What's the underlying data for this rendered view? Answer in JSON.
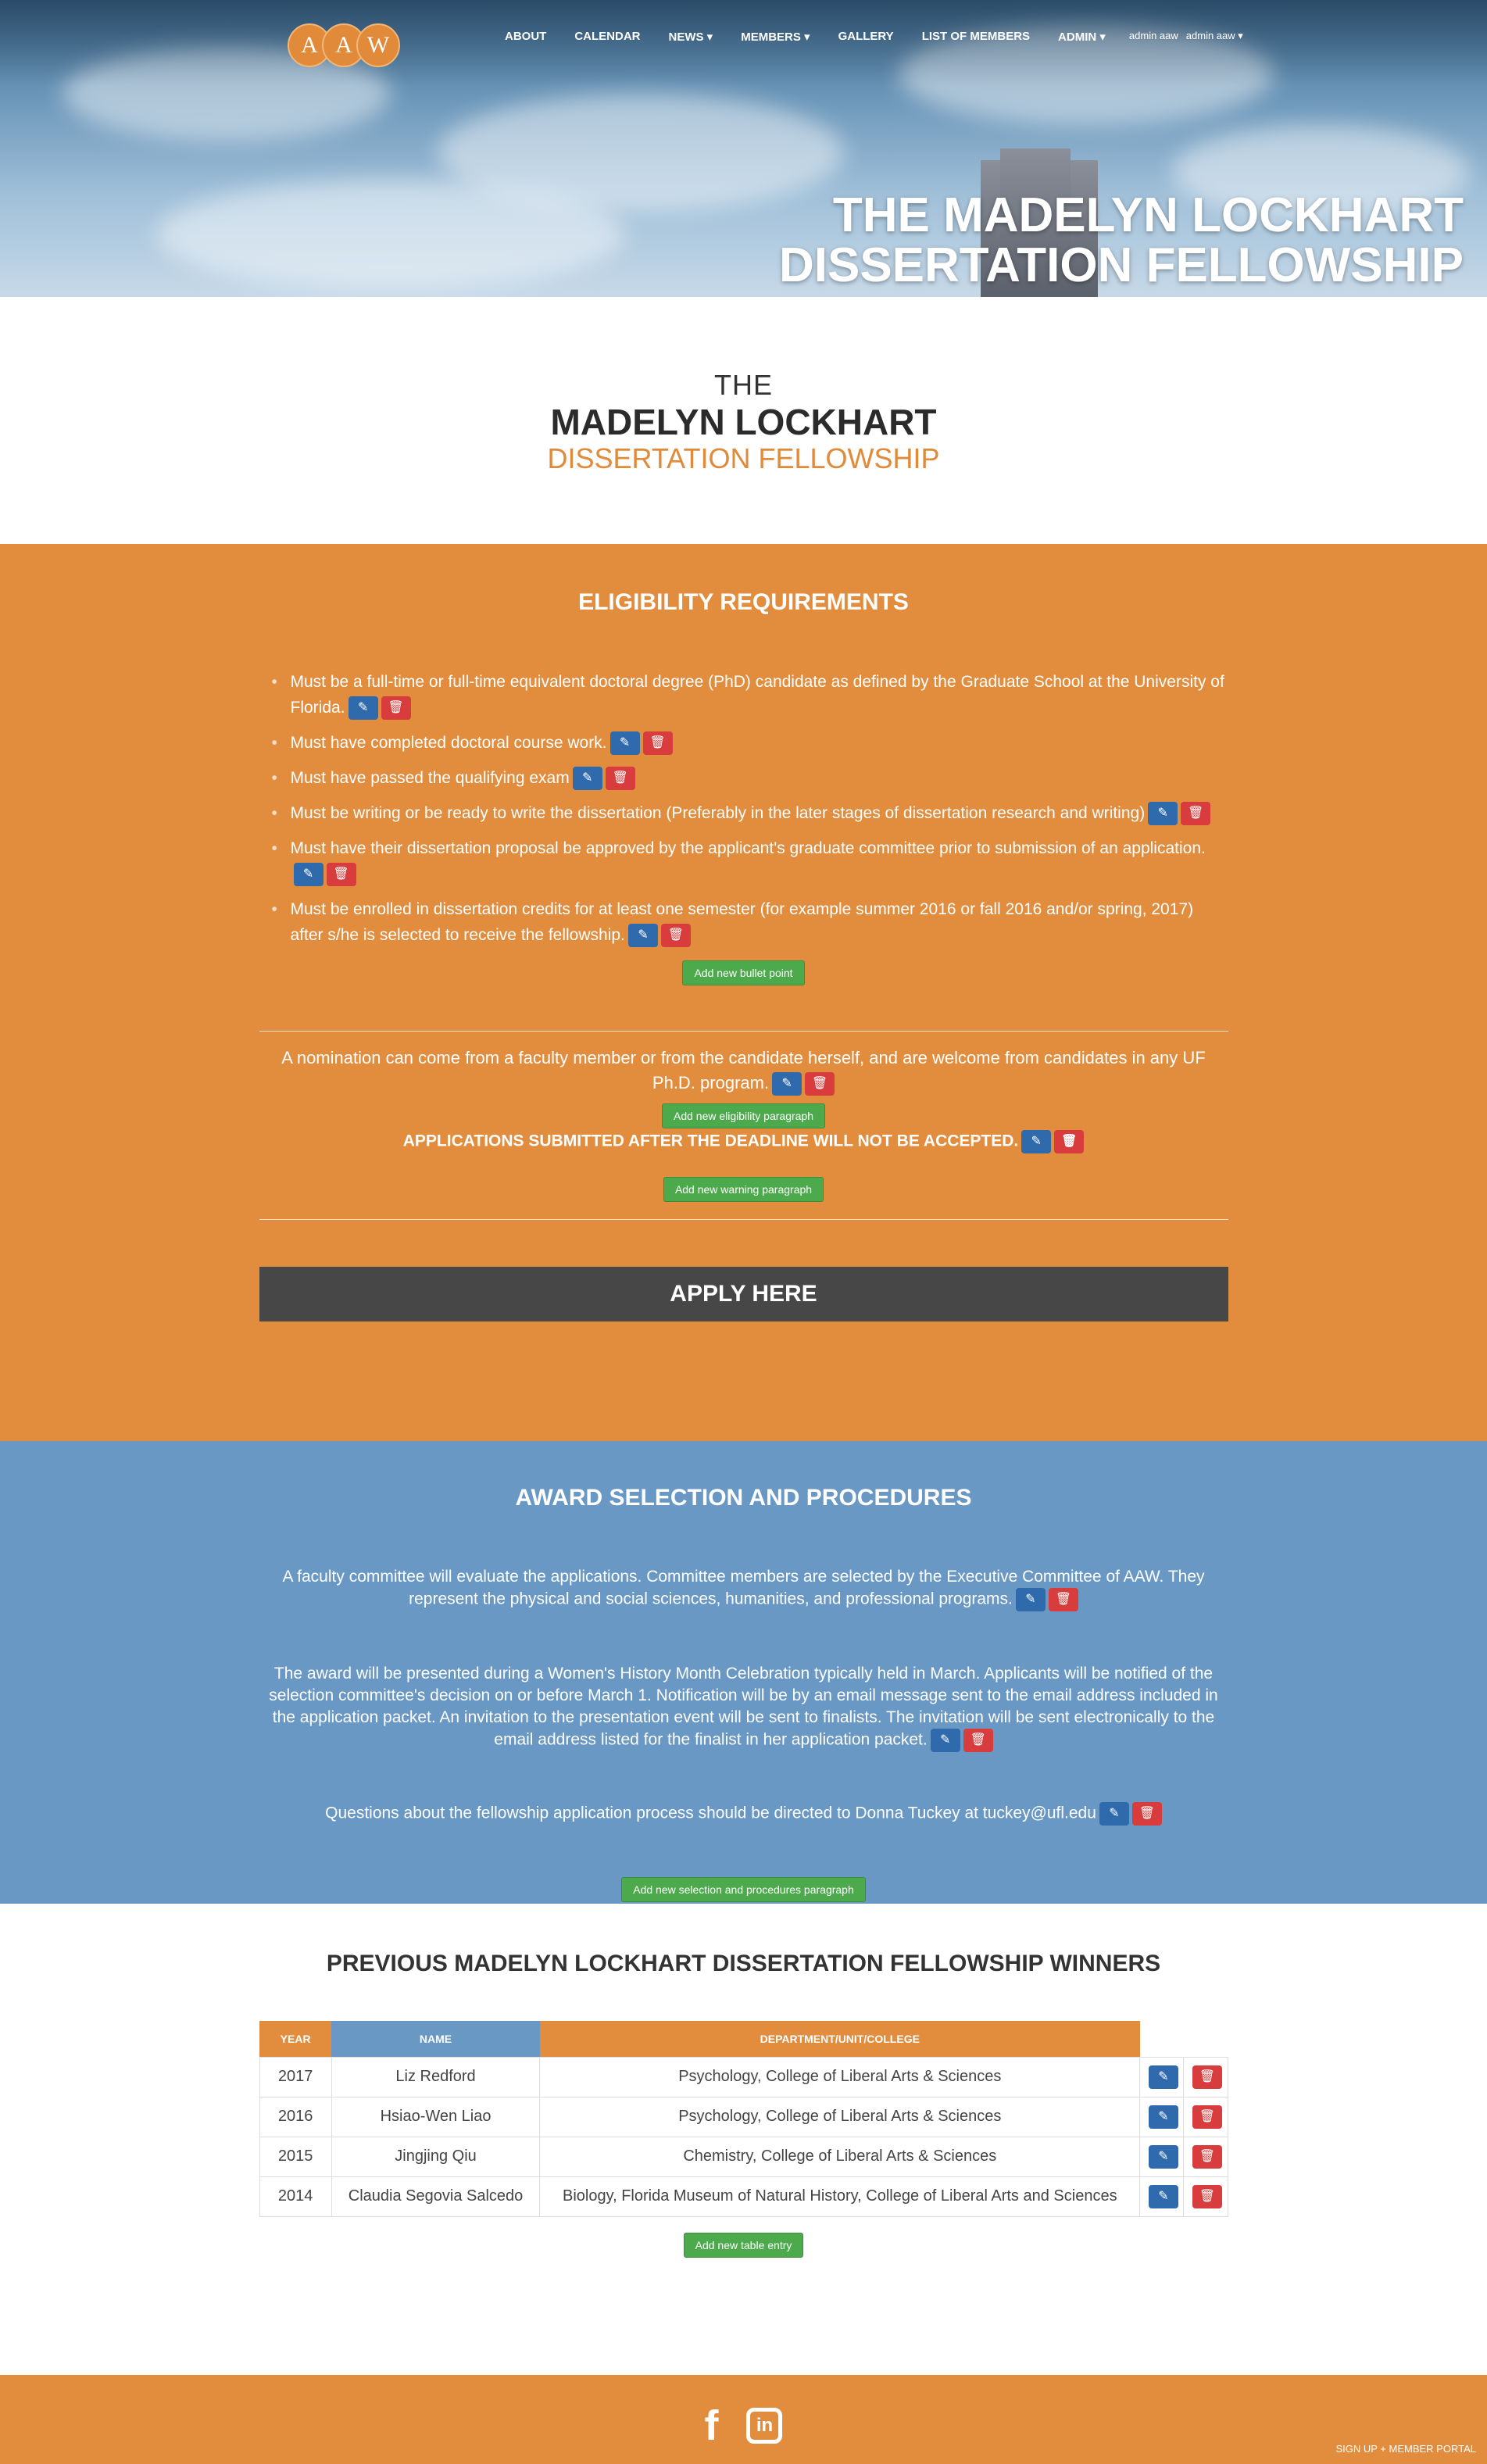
{
  "logo": {
    "letters": [
      "A",
      "A",
      "W"
    ]
  },
  "nav": {
    "items": [
      "ABOUT",
      "CALENDAR",
      "NEWS ▾",
      "MEMBERS ▾",
      "GALLERY",
      "LIST OF MEMBERS",
      "ADMIN ▾"
    ],
    "user_name": "admin aaw",
    "user_menu": "admin aaw ▾"
  },
  "hero": {
    "title_line1": "THE MADELYN LOCKHART",
    "title_line2": "DISSERTATION FELLOWSHIP"
  },
  "intro": {
    "line1": "THE",
    "line2": "MADELYN LOCKHART",
    "line3": "DISSERTATION FELLOWSHIP"
  },
  "eligibility": {
    "title": "ELIGIBILITY REQUIREMENTS",
    "bullets": [
      "Must be a full-time or full-time equivalent doctoral degree (PhD) candidate as defined by the Graduate School at the University of Florida.",
      "Must have completed doctoral course work.",
      "Must have passed the qualifying exam",
      "Must be writing or be ready to write the dissertation (Preferably in the later stages of dissertation research and writing)",
      "Must have their dissertation proposal be approved by the applicant's graduate committee prior to submission of an application.",
      "Must be enrolled in dissertation credits for at least one semester (for example summer 2016 or fall 2016 and/or spring, 2017) after s/he is selected to receive the fellowship."
    ],
    "add_bullet": "Add new bullet point",
    "nomination": "A nomination can come from a faculty member or from the candidate herself, and are welcome from candidates in any UF Ph.D. program.",
    "add_paragraph": "Add new eligibility paragraph",
    "warning": "APPLICATIONS SUBMITTED AFTER THE DEADLINE WILL NOT BE ACCEPTED.",
    "add_warning": "Add new warning paragraph",
    "apply": "APPLY HERE"
  },
  "award": {
    "title": "AWARD SELECTION AND PROCEDURES",
    "paragraphs": [
      "A faculty committee will evaluate the applications. Committee members are selected by the Executive Committee of AAW. They represent the physical and social sciences, humanities, and professional programs.",
      "The award will be presented during a Women's History Month Celebration typically held in March. Applicants will be notified of the selection committee's decision on or before March 1. Notification will be by an email message sent to the email address included in the application packet. An invitation to the presentation event will be sent to finalists. The invitation will be sent electronically to the email address listed for the finalist in her application packet.",
      "Questions about the fellowship application process should be directed to Donna Tuckey at tuckey@ufl.edu"
    ],
    "add_paragraph": "Add new selection and procedures paragraph"
  },
  "winners": {
    "title": "PREVIOUS MADELYN LOCKHART DISSERTATION FELLOWSHIP WINNERS",
    "columns": [
      "YEAR",
      "NAME",
      "DEPARTMENT/UNIT/COLLEGE"
    ],
    "rows": [
      [
        "2017",
        "Liz Redford",
        "Psychology, College of Liberal Arts & Sciences"
      ],
      [
        "2016",
        "Hsiao-Wen Liao",
        "Psychology, College of Liberal Arts & Sciences"
      ],
      [
        "2015",
        "Jingjing Qiu",
        "Chemistry, College of Liberal Arts & Sciences"
      ],
      [
        "2014",
        "Claudia Segovia Salcedo",
        "Biology, Florida Museum of Natural History, College of Liberal Arts and Sciences"
      ]
    ],
    "add_entry": "Add new table entry"
  },
  "footer": {
    "facebook": "f",
    "linkedin": "in",
    "portal": "SIGN UP + MEMBER PORTAL"
  },
  "colors": {
    "orange": "#e28d3e",
    "blue": "#6998c4",
    "dark": "#474747",
    "edit": "#2f6aad",
    "delete": "#d83c3c",
    "add": "#4caa4c"
  }
}
